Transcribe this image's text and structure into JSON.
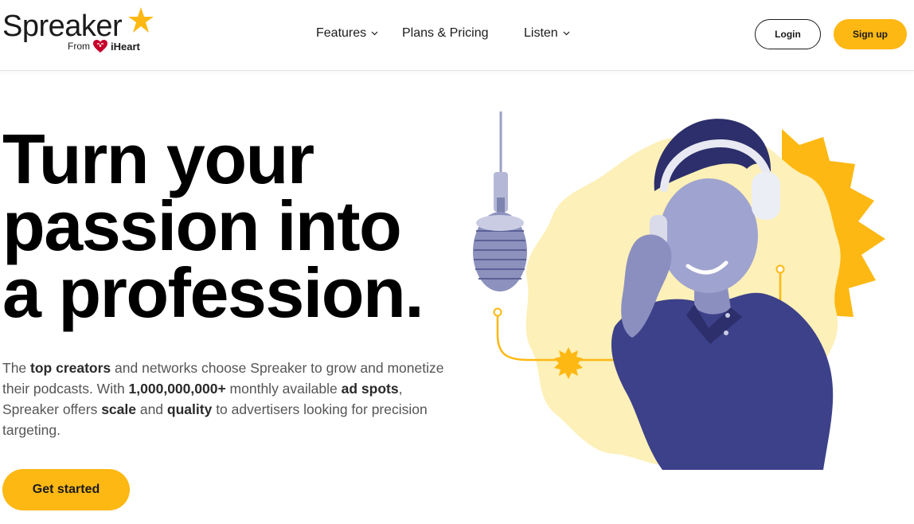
{
  "brand": {
    "name": "Spreaker",
    "from_label": "From",
    "partner": "iHeart",
    "accent_color": "#fdb813",
    "partner_color": "#c6002b"
  },
  "nav": {
    "items": [
      {
        "label": "Features",
        "has_dropdown": true
      },
      {
        "label": "Plans & Pricing",
        "has_dropdown": false
      },
      {
        "label": "Listen",
        "has_dropdown": true
      }
    ]
  },
  "auth": {
    "login_label": "Login",
    "signup_label": "Sign up"
  },
  "hero": {
    "headline_lines": [
      "Turn your",
      "passion into",
      "a profession."
    ],
    "description": {
      "p1": "The ",
      "b1": "top creators",
      "p2": " and networks choose Spreaker to grow and monetize their podcasts. With ",
      "b2": "1,000,000,000+",
      "p3": " monthly available ",
      "b3": "ad spots",
      "p4": ", Spreaker offers ",
      "b4": "scale",
      "p5": " and ",
      "b5": "quality",
      "p6": " to advertisers looking for precision targeting."
    },
    "cta_label": "Get started",
    "illustration_icon": "podcaster-with-headphones-and-microphone-illustration"
  }
}
